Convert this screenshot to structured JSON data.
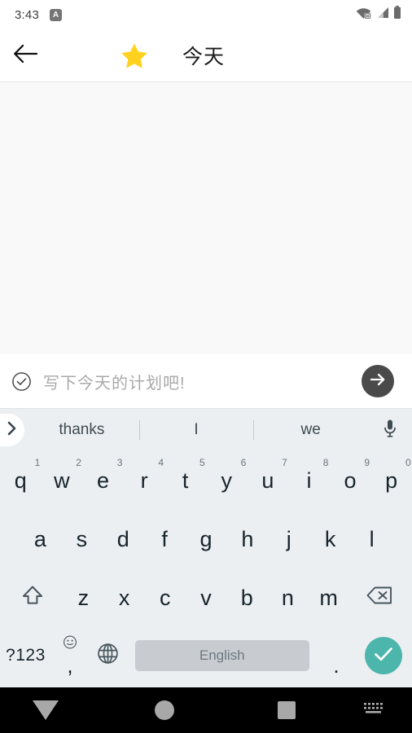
{
  "status_bar": {
    "time": "3:43",
    "notification_badge": "A",
    "icons": [
      "wifi-off-icon",
      "cellular-signal-icon",
      "battery-icon"
    ]
  },
  "app_bar": {
    "back_icon": "arrow-left-icon",
    "star_icon": "star-icon",
    "title": "今天"
  },
  "note": {
    "body_text": ""
  },
  "input": {
    "check_icon": "check-circle-icon",
    "placeholder": "写下今天的计划吧!",
    "value": "",
    "send_icon": "arrow-right-icon"
  },
  "keyboard": {
    "expand_icon": "chevron-right-icon",
    "suggestions": [
      "thanks",
      "I",
      "we"
    ],
    "mic_icon": "microphone-icon",
    "row1": [
      {
        "key": "q",
        "sup": "1"
      },
      {
        "key": "w",
        "sup": "2"
      },
      {
        "key": "e",
        "sup": "3"
      },
      {
        "key": "r",
        "sup": "4"
      },
      {
        "key": "t",
        "sup": "5"
      },
      {
        "key": "y",
        "sup": "6"
      },
      {
        "key": "u",
        "sup": "7"
      },
      {
        "key": "i",
        "sup": "8"
      },
      {
        "key": "o",
        "sup": "9"
      },
      {
        "key": "p",
        "sup": "0"
      }
    ],
    "row2": [
      "a",
      "s",
      "d",
      "f",
      "g",
      "h",
      "j",
      "k",
      "l"
    ],
    "row3": [
      "z",
      "x",
      "c",
      "v",
      "b",
      "n",
      "m"
    ],
    "shift_icon": "shift-icon",
    "backspace_icon": "backspace-icon",
    "symbols_key": "?123",
    "comma_key": ",",
    "emoji_icon": "emoji-smiley-icon",
    "globe_icon": "globe-language-icon",
    "space_label": "English",
    "period_key": ".",
    "enter_icon": "check-icon"
  },
  "nav_bar": {
    "back_icon": "nav-down-triangle-icon",
    "home_icon": "nav-home-circle-icon",
    "recents_icon": "nav-recents-square-icon",
    "keyboard_indicator_icon": "keyboard-indicator-icon"
  },
  "colors": {
    "star": "#FFD220",
    "enter_accent": "#4DB6AC",
    "send_button": "#4A4A4A",
    "keyboard_bg": "#ECEFF1",
    "note_bg": "#F9F9F9"
  }
}
